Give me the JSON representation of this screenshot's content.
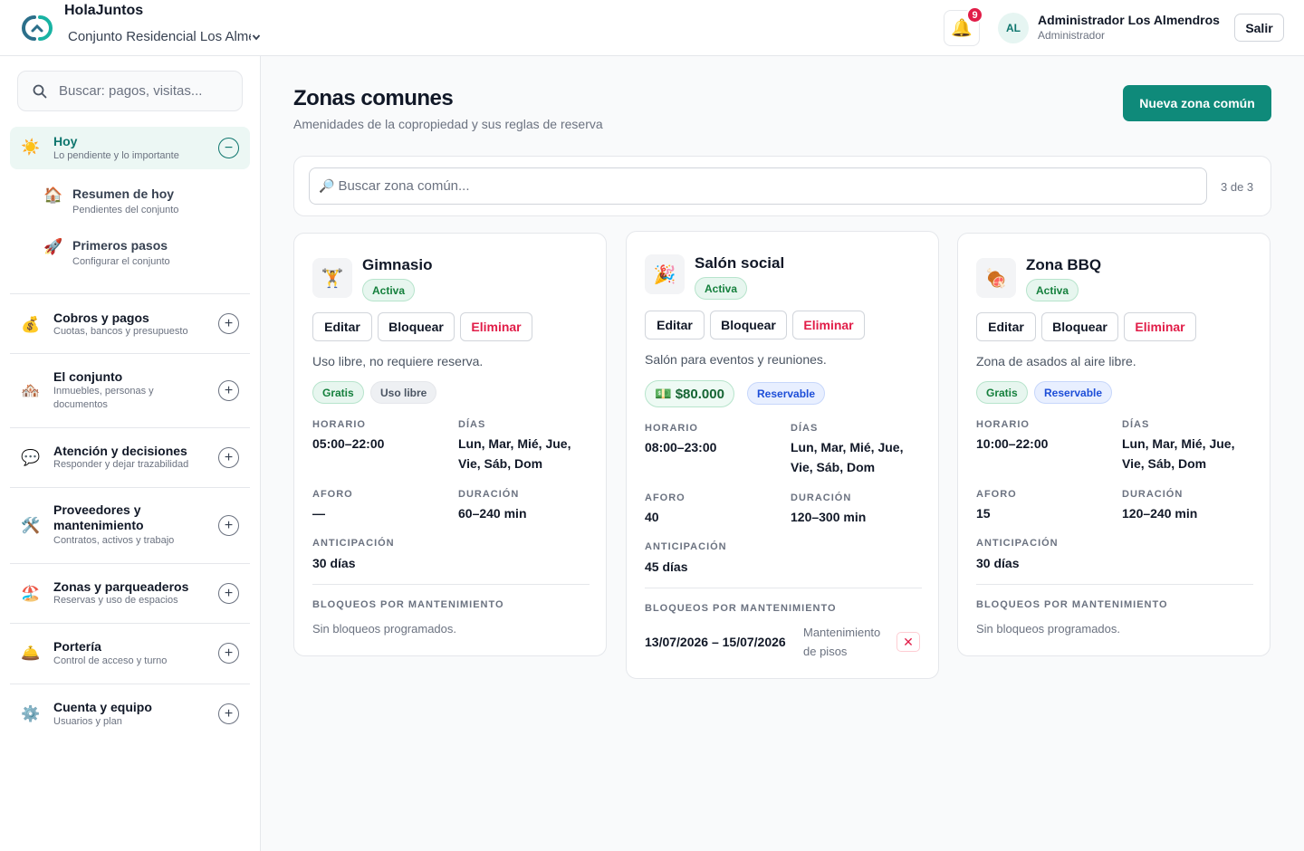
{
  "header": {
    "app_title": "HolaJuntos",
    "condo_name": "Conjunto Residencial Los Almendros",
    "notifications_count": "9",
    "avatar_initials": "AL",
    "user_name": "Administrador Los Almendros",
    "user_role": "Administrador",
    "logout_label": "Salir",
    "brand_color": "#0f8a7a"
  },
  "sidebar": {
    "search_placeholder": "Buscar: pagos, visitas...",
    "today": {
      "icon": "☀️",
      "title": "Hoy",
      "subtitle": "Lo pendiente y lo importante",
      "sub_items": [
        {
          "icon": "🏠",
          "title": "Resumen de hoy",
          "subtitle": "Pendientes del conjunto"
        },
        {
          "icon": "🚀",
          "title": "Primeros pasos",
          "subtitle": "Configurar el conjunto"
        }
      ]
    },
    "sections": [
      {
        "icon": "💰",
        "title": "Cobros y pagos",
        "subtitle": "Cuotas, bancos y presupuesto"
      },
      {
        "icon": "🏘️",
        "title": "El conjunto",
        "subtitle": "Inmuebles, personas y documentos"
      },
      {
        "icon": "💬",
        "title": "Atención y decisiones",
        "subtitle": "Responder y dejar trazabilidad"
      },
      {
        "icon": "🛠️",
        "title": "Proveedores y mantenimiento",
        "subtitle": "Contratos, activos y trabajo"
      },
      {
        "icon": "🏖️",
        "title": "Zonas y parqueaderos",
        "subtitle": "Reservas y uso de espacios"
      },
      {
        "icon": "🛎️",
        "title": "Portería",
        "subtitle": "Control de acceso y turno"
      },
      {
        "icon": "⚙️",
        "title": "Cuenta y equipo",
        "subtitle": "Usuarios y plan"
      }
    ]
  },
  "main": {
    "title": "Zonas comunes",
    "subtitle": "Amenidades de la copropiedad y sus reglas de reserva",
    "new_button": "Nueva zona común",
    "search_placeholder": "Buscar zona común...",
    "count": "3 de 3",
    "labels": {
      "horario": "HORARIO",
      "dias": "DÍAS",
      "aforo": "AFORO",
      "duracion": "DURACIÓN",
      "anticipacion": "ANTICIPACIÓN",
      "bloqueos": "BLOQUEOS POR MANTENIMIENTO",
      "edit": "Editar",
      "block": "Bloquear",
      "delete": "Eliminar"
    },
    "zones": [
      {
        "icon": "🏋️",
        "name": "Gimnasio",
        "status": "Activa",
        "description": "Uso libre, no requiere reserva.",
        "tags": [
          "Gratis",
          "Uso libre"
        ],
        "horario": "05:00–22:00",
        "dias": "Lun, Mar, Mié, Jue, Vie, Sáb, Dom",
        "aforo": "—",
        "duracion": "60–240 min",
        "anticipacion": "30 días",
        "no_blocks": "Sin bloqueos programados."
      },
      {
        "icon": "🎉",
        "name": "Salón social",
        "status": "Activa",
        "description": "Salón para eventos y reuniones.",
        "price_icon": "💵",
        "price": "$80.000",
        "tags": [
          "Reservable"
        ],
        "horario": "08:00–23:00",
        "dias": "Lun, Mar, Mié, Jue, Vie, Sáb, Dom",
        "aforo": "40",
        "duracion": "120–300 min",
        "anticipacion": "45 días",
        "block_dates": "13/07/2026 – 15/07/2026",
        "block_reason": "Mantenimiento de pisos"
      },
      {
        "icon": "🍖",
        "name": "Zona BBQ",
        "status": "Activa",
        "description": "Zona de asados al aire libre.",
        "tags": [
          "Gratis",
          "Reservable"
        ],
        "horario": "10:00–22:00",
        "dias": "Lun, Mar, Mié, Jue, Vie, Sáb, Dom",
        "aforo": "15",
        "duracion": "120–240 min",
        "anticipacion": "30 días",
        "no_blocks": "Sin bloqueos programados."
      }
    ]
  }
}
